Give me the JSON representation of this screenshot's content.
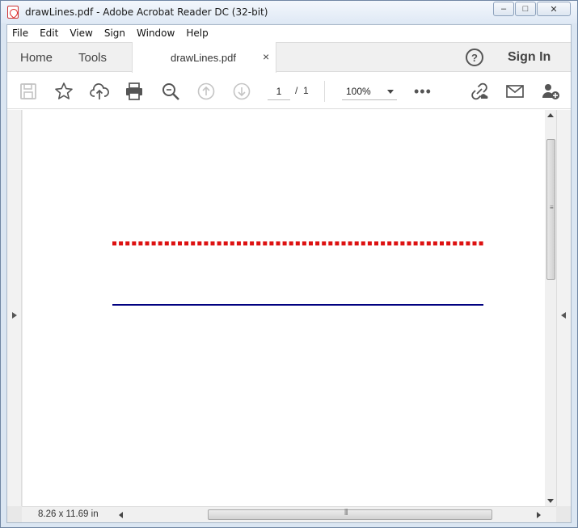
{
  "window": {
    "title": "drawLines.pdf - Adobe Acrobat Reader DC (32-bit)",
    "minimize": "–",
    "maximize": "□",
    "close": "✕"
  },
  "menu": [
    "File",
    "Edit",
    "View",
    "Sign",
    "Window",
    "Help"
  ],
  "tabs": {
    "home": "Home",
    "tools": "Tools",
    "document": "drawLines.pdf",
    "close": "×",
    "help": "?",
    "sign_in": "Sign In"
  },
  "toolbar": {
    "icons": [
      "save-icon",
      "bookmark-star-icon",
      "cloud-upload-icon",
      "print-icon",
      "zoom-search-icon",
      "page-up-icon",
      "page-down-icon"
    ],
    "page_current": "1",
    "page_separator": "/",
    "page_total": "1",
    "zoom": "100%",
    "more": "•••",
    "right_icons": [
      "share-link-icon",
      "email-icon",
      "add-user-icon"
    ]
  },
  "document": {
    "lines": [
      {
        "style": "dotted",
        "color": "#dd1111"
      },
      {
        "style": "solid",
        "color": "#000080"
      }
    ]
  },
  "status": {
    "page_size": "8.26 x 11.69 in"
  },
  "colors": {
    "accent_line_red": "#dd1111",
    "accent_line_navy": "#000080"
  }
}
